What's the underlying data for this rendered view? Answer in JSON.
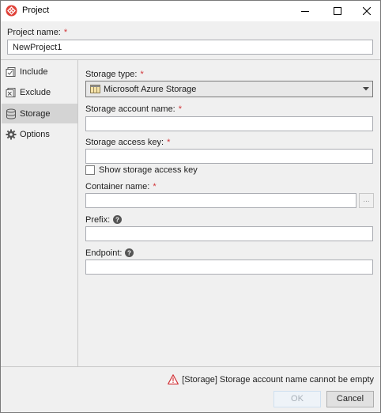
{
  "window": {
    "title": "Project",
    "controls": [
      "minimize-icon",
      "maximize-icon",
      "close-icon"
    ]
  },
  "project_name": {
    "label": "Project name:",
    "required_mark": "*",
    "value": "NewProject1"
  },
  "sidebar": {
    "items": [
      {
        "label": "Include",
        "icon": "include-icon",
        "selected": false
      },
      {
        "label": "Exclude",
        "icon": "exclude-icon",
        "selected": false
      },
      {
        "label": "Storage",
        "icon": "database-icon",
        "selected": true
      },
      {
        "label": "Options",
        "icon": "gear-icon",
        "selected": false
      }
    ]
  },
  "storage": {
    "type_label": "Storage type:",
    "type_value": "Microsoft Azure Storage",
    "account_name_label": "Storage account name:",
    "account_name_value": "",
    "access_key_label": "Storage access key:",
    "access_key_value": "",
    "show_key_label": "Show storage access key",
    "show_key_checked": false,
    "container_label": "Container name:",
    "container_value": "",
    "browse_label": "...",
    "prefix_label": "Prefix:",
    "prefix_value": "",
    "endpoint_label": "Endpoint:",
    "endpoint_value": "",
    "required_mark": "*"
  },
  "footer": {
    "error_text": "[Storage] Storage account name cannot be empty",
    "ok_label": "OK",
    "cancel_label": "Cancel"
  },
  "colors": {
    "required": "#d13438",
    "error_icon": "#d13438",
    "app_icon": "#e0433a"
  }
}
